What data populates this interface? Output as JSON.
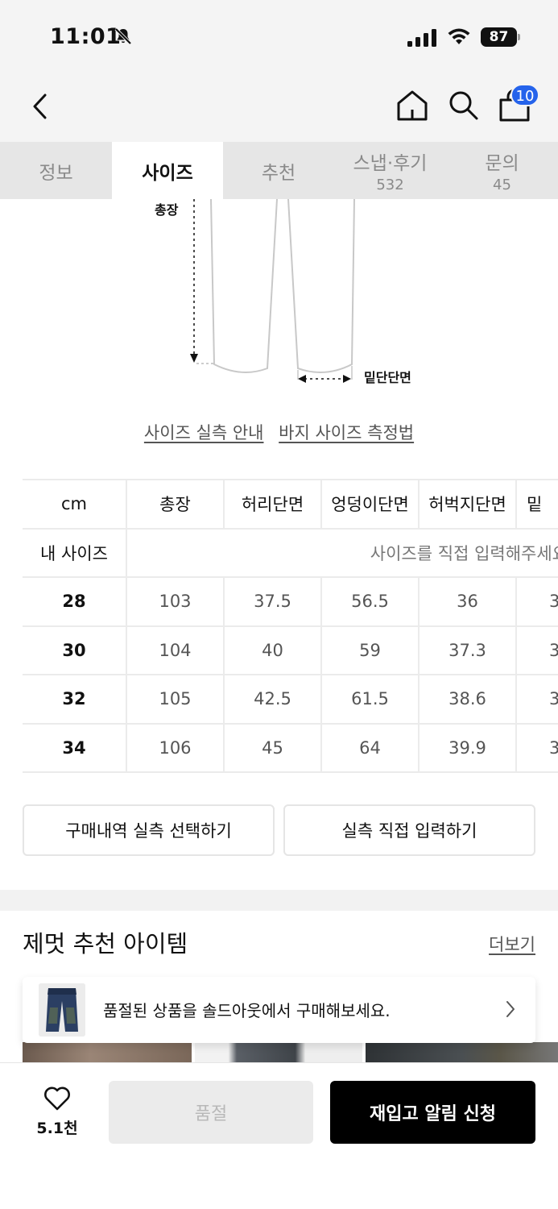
{
  "status": {
    "time": "11:01",
    "battery": "87"
  },
  "header": {
    "cart_count": "10"
  },
  "tabs": [
    {
      "label": "정보",
      "count": ""
    },
    {
      "label": "사이즈",
      "count": ""
    },
    {
      "label": "추천",
      "count": ""
    },
    {
      "label": "스냅·후기",
      "count": "532"
    },
    {
      "label": "문의",
      "count": "45"
    }
  ],
  "diagram": {
    "length_label": "총장",
    "hem_label": "밑단단면"
  },
  "size_links": {
    "guide": "사이즈 실측 안내",
    "method": "바지 사이즈 측정법"
  },
  "size_table": {
    "unit": "cm",
    "columns": [
      "총장",
      "허리단면",
      "엉덩이단면",
      "허벅지단면",
      "밑"
    ],
    "my_size_label": "내 사이즈",
    "my_size_placeholder": "사이즈를 직접 입력해주세요",
    "rows": [
      {
        "size": "28",
        "values": [
          "103",
          "37.5",
          "56.5",
          "36",
          "3"
        ]
      },
      {
        "size": "30",
        "values": [
          "104",
          "40",
          "59",
          "37.3",
          "3"
        ]
      },
      {
        "size": "32",
        "values": [
          "105",
          "42.5",
          "61.5",
          "38.6",
          "3"
        ]
      },
      {
        "size": "34",
        "values": [
          "106",
          "45",
          "64",
          "39.9",
          "3"
        ]
      }
    ]
  },
  "buttons": {
    "purchase_history": "구매내역 실측 선택하기",
    "direct_input": "실측 직접 입력하기"
  },
  "recommend": {
    "title": "제멋 추천 아이템",
    "more": "더보기",
    "soldout_notice": "품절된 상품을 솔드아웃에서 구매해보세요."
  },
  "bottom": {
    "like_count": "5.1천",
    "soldout_label": "품절",
    "restock_label": "재입고 알림 신청"
  },
  "colors": {
    "accent_badge": "#2563eb",
    "primary_button": "#000000"
  }
}
